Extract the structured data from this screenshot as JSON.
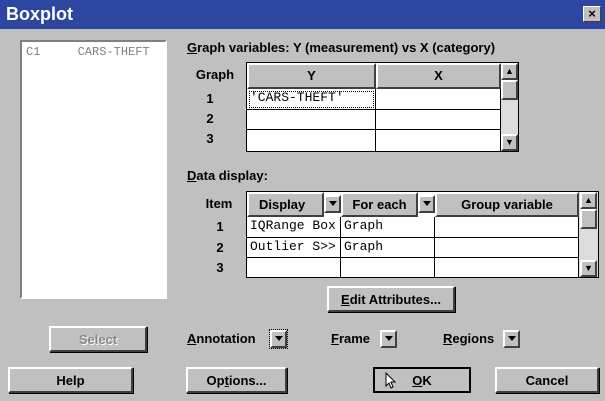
{
  "window": {
    "title": "Boxplot",
    "close_glyph": "×"
  },
  "variables": [
    {
      "id": "C1",
      "name": "CARS-THEFT"
    }
  ],
  "graph_vars": {
    "label_prefix": "G",
    "label_rest": "raph variables:  Y (measurement) vs X (category)",
    "header_graph": "Graph",
    "header_y": "Y",
    "header_x": "X",
    "rows": [
      {
        "num": "1",
        "y": "'CARS-THEFT'",
        "x": ""
      },
      {
        "num": "2",
        "y": "",
        "x": ""
      },
      {
        "num": "3",
        "y": "",
        "x": ""
      }
    ]
  },
  "data_display": {
    "label_prefix": "D",
    "label_rest": "ata display:",
    "header_item": "Item",
    "header_display": "Display",
    "header_foreach": "For each",
    "header_group": "Group variable",
    "rows": [
      {
        "num": "1",
        "display": "IQRange Box",
        "foreach": "Graph",
        "group": ""
      },
      {
        "num": "2",
        "display": "Outlier S>>",
        "foreach": "Graph",
        "group": ""
      },
      {
        "num": "3",
        "display": "",
        "foreach": "",
        "group": ""
      }
    ]
  },
  "buttons": {
    "edit_attributes_u": "E",
    "edit_attributes_rest": "dit Attributes...",
    "select": "Select",
    "help": "Help",
    "options_pre": "Op",
    "options_u": "t",
    "options_rest": "ions...",
    "ok_u": "O",
    "ok_rest": "K",
    "cancel": "Cancel"
  },
  "dropdowns": {
    "annotation_u": "A",
    "annotation_rest": "nnotation",
    "frame_u": "F",
    "frame_rest": "rame",
    "regions_u": "R",
    "regions_rest": "egions"
  },
  "colors": {
    "titlebar": "#2d46a0",
    "face": "#c0c0c0"
  }
}
